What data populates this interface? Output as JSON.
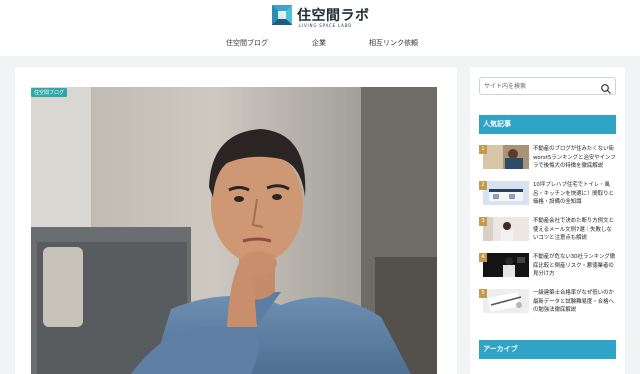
{
  "brand": {
    "name": "住空間ラボ",
    "tagline": "LIVING SPACE LABO",
    "colors": {
      "mark_dark": "#1e6a86",
      "mark_light": "#2fa4c7"
    }
  },
  "nav": {
    "items": [
      {
        "label": "住空間ブログ"
      },
      {
        "label": "企業"
      },
      {
        "label": "相互リンク依頼"
      }
    ]
  },
  "article": {
    "category_badge": "住空間ブログ",
    "image_subject": "thinking-man-photo"
  },
  "sidebar": {
    "search": {
      "placeholder": "サイト内を検索",
      "icon": "search-icon"
    },
    "popular": {
      "heading": "人気記事",
      "items": [
        {
          "rank": "1",
          "title": "不動産のブログが住みたくない街worst5ランキングと治安やインフラで後悔大の特徴を徹底解説"
        },
        {
          "rank": "2",
          "title": "10坪プレハブ住宅でトイレ・風呂・キッチンを快適に！間取りと価格・設備の全知識"
        },
        {
          "rank": "3",
          "title": "不動産会社で決めた断り方例文と使えるメール文例7選｜失敗しないコツと注意点も解説"
        },
        {
          "rank": "4",
          "title": "不動産が危ない30社ランキング徹底比較と倒産リスク・悪徳業者の見分け方"
        },
        {
          "rank": "5",
          "title": "一級建築士合格率がなぜ低いのか最新データと試験難易度・合格への勉強法徹底解説"
        }
      ]
    },
    "archive": {
      "heading": "アーカイブ"
    }
  },
  "colors": {
    "accent": "#2fa4c7",
    "badge": "#2fa8a8",
    "rank": "#c59a4a"
  }
}
